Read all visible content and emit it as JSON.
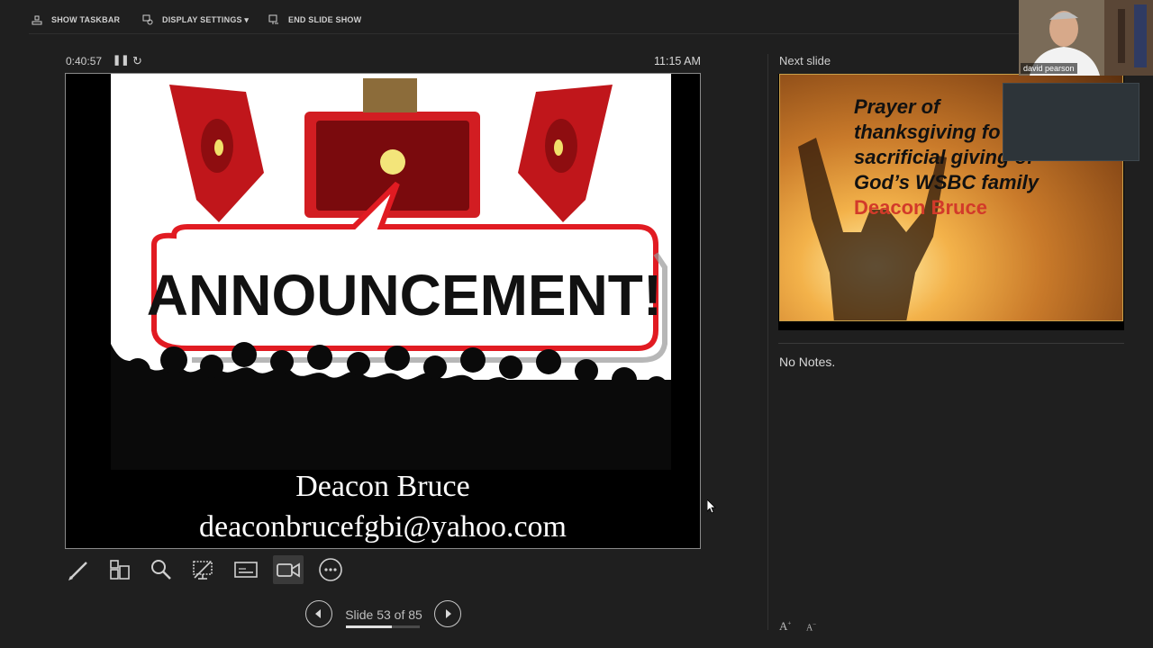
{
  "toolbar": {
    "show_taskbar": "SHOW TASKBAR",
    "display_settings": "DISPLAY SETTINGS ▾",
    "end_slide_show": "END SLIDE SHOW"
  },
  "timer": {
    "elapsed": "0:40:57",
    "clock": "11:15 AM"
  },
  "current_slide": {
    "heading_graphic_text": "ANNOUNCEMENT!",
    "caption_name": "Deacon Bruce",
    "caption_email": "deaconbrucefgbi@yahoo.com"
  },
  "tools": [
    "pen-tool",
    "see-all-slides",
    "zoom",
    "black-screen",
    "subtitles",
    "camera",
    "more-options"
  ],
  "navigation": {
    "counter": "Slide 53 of 85",
    "current": 53,
    "total": 85
  },
  "next_slide": {
    "label": "Next slide",
    "lines": [
      "Prayer of",
      "thanksgiving fo",
      "sacrificial giving of",
      "God’s WSBC family"
    ],
    "highlight": "Deacon Bruce"
  },
  "notes": {
    "text": "No Notes."
  },
  "webcam": {
    "name": "david pearson"
  },
  "font_controls": {
    "increase": "A",
    "decrease": "A"
  },
  "colors": {
    "background": "#1f1f1f",
    "accent_red": "#d23a2a"
  }
}
